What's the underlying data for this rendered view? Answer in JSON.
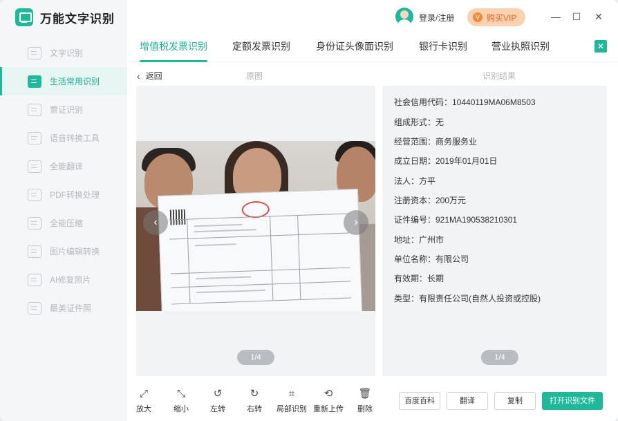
{
  "app": {
    "title": "万能文字识别"
  },
  "sidebar": {
    "items": [
      {
        "label": "文字识别",
        "icon": "text-scan-icon"
      },
      {
        "label": "生活常用识别",
        "icon": "face-scan-icon"
      },
      {
        "label": "票证识别",
        "icon": "ticket-scan-icon"
      },
      {
        "label": "语音转换工具",
        "icon": "voice-icon"
      },
      {
        "label": "全能翻译",
        "icon": "translate-icon"
      },
      {
        "label": "PDF转换处理",
        "icon": "pdf-icon"
      },
      {
        "label": "全能压缩",
        "icon": "compress-icon"
      },
      {
        "label": "图片编辑转换",
        "icon": "image-edit-icon"
      },
      {
        "label": "AI修复照片",
        "icon": "ai-photo-icon"
      },
      {
        "label": "最美证件照",
        "icon": "id-photo-icon"
      }
    ],
    "active_index": 1
  },
  "header": {
    "login_label": "登录/注册",
    "vip_label": "购买VIP",
    "minimize": "—",
    "maximize": "☐",
    "close": "✕"
  },
  "tabs": [
    {
      "label": "增值税发票识别"
    },
    {
      "label": "定额发票识别"
    },
    {
      "label": "身份证头像面识别"
    },
    {
      "label": "银行卡识别"
    },
    {
      "label": "营业执照识别"
    }
  ],
  "view": {
    "back_label": "返回",
    "original_label": "原图",
    "result_label": "识别结果",
    "page_original": "1/4",
    "page_result": "1/4"
  },
  "result": {
    "lines": [
      "社会信用代码：10440119MA06M8503",
      "组成形式：无",
      "经营范围：商务服务业",
      "成立日期：2019年01月01日",
      "法人：方平",
      "注册资本：200万元",
      "证件编号：921MA190538210301",
      "地址：广州市",
      "单位名称：有限公司",
      "有效期：长期",
      "类型：有限责任公司(自然人投资或控股)"
    ]
  },
  "toolbar": {
    "zoom_in": "放大",
    "zoom_out": "缩小",
    "rotate_left": "左转",
    "rotate_right": "右转",
    "crop_recognize": "局部识别",
    "reupload": "重新上传",
    "delete": "删除"
  },
  "actions": {
    "baike": "百度百科",
    "translate": "翻译",
    "copy": "复制",
    "open_file": "打开识别文件"
  },
  "colors": {
    "accent": "#1fb89a",
    "vip_bg": "#fcd1b0",
    "vip_text": "#e0621b"
  }
}
